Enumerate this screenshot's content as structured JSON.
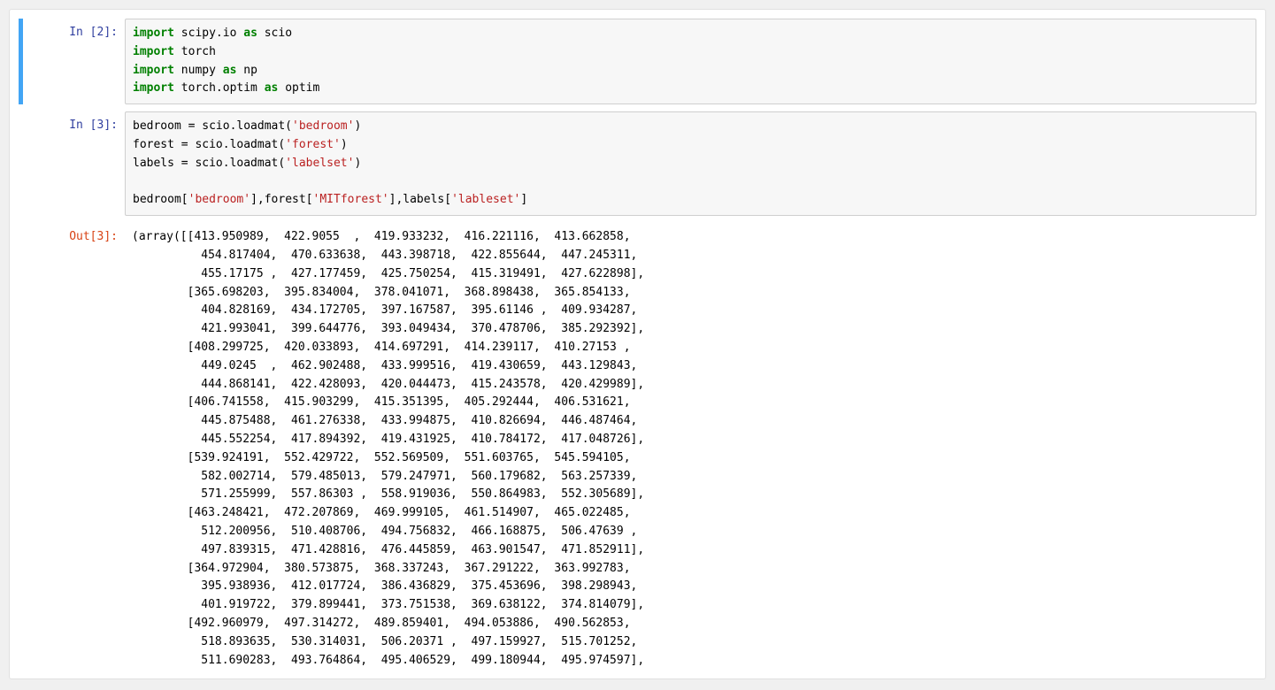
{
  "cells": [
    {
      "prompt_label": "In  [2]:",
      "selected": true,
      "code_tokens": [
        {
          "t": "import",
          "c": "kw"
        },
        {
          "t": " scipy.io ",
          "c": "nm"
        },
        {
          "t": "as",
          "c": "kw"
        },
        {
          "t": " scio",
          "c": "nm"
        },
        {
          "t": "\n",
          "c": ""
        },
        {
          "t": "import",
          "c": "kw"
        },
        {
          "t": " torch",
          "c": "nm"
        },
        {
          "t": "\n",
          "c": ""
        },
        {
          "t": "import",
          "c": "kw"
        },
        {
          "t": " numpy ",
          "c": "nm"
        },
        {
          "t": "as",
          "c": "kw"
        },
        {
          "t": " np",
          "c": "nm"
        },
        {
          "t": "\n",
          "c": ""
        },
        {
          "t": "import",
          "c": "kw"
        },
        {
          "t": " torch.optim ",
          "c": "nm"
        },
        {
          "t": "as",
          "c": "kw"
        },
        {
          "t": " optim",
          "c": "nm"
        }
      ]
    },
    {
      "prompt_label": "In  [3]:",
      "selected": false,
      "code_tokens": [
        {
          "t": "bedroom = scio.loadmat(",
          "c": "nm"
        },
        {
          "t": "'bedroom'",
          "c": "str"
        },
        {
          "t": ")",
          "c": "nm"
        },
        {
          "t": "\n",
          "c": ""
        },
        {
          "t": "forest = scio.loadmat(",
          "c": "nm"
        },
        {
          "t": "'forest'",
          "c": "str"
        },
        {
          "t": ")",
          "c": "nm"
        },
        {
          "t": "\n",
          "c": ""
        },
        {
          "t": "labels = scio.loadmat(",
          "c": "nm"
        },
        {
          "t": "'labelset'",
          "c": "str"
        },
        {
          "t": ")",
          "c": "nm"
        },
        {
          "t": "\n",
          "c": ""
        },
        {
          "t": "\n",
          "c": ""
        },
        {
          "t": "bedroom[",
          "c": "nm"
        },
        {
          "t": "'bedroom'",
          "c": "str"
        },
        {
          "t": "],forest[",
          "c": "nm"
        },
        {
          "t": "'MITforest'",
          "c": "str"
        },
        {
          "t": "],labels[",
          "c": "nm"
        },
        {
          "t": "'lableset'",
          "c": "str"
        },
        {
          "t": "]",
          "c": "nm"
        }
      ],
      "out_prompt_label": "Out[3]:",
      "output_text": "(array([[413.950989,  422.9055  ,  419.933232,  416.221116,  413.662858,\n          454.817404,  470.633638,  443.398718,  422.855644,  447.245311,\n          455.17175 ,  427.177459,  425.750254,  415.319491,  427.622898],\n        [365.698203,  395.834004,  378.041071,  368.898438,  365.854133,\n          404.828169,  434.172705,  397.167587,  395.61146 ,  409.934287,\n          421.993041,  399.644776,  393.049434,  370.478706,  385.292392],\n        [408.299725,  420.033893,  414.697291,  414.239117,  410.27153 ,\n          449.0245  ,  462.902488,  433.999516,  419.430659,  443.129843,\n          444.868141,  422.428093,  420.044473,  415.243578,  420.429989],\n        [406.741558,  415.903299,  415.351395,  405.292444,  406.531621,\n          445.875488,  461.276338,  433.994875,  410.826694,  446.487464,\n          445.552254,  417.894392,  419.431925,  410.784172,  417.048726],\n        [539.924191,  552.429722,  552.569509,  551.603765,  545.594105,\n          582.002714,  579.485013,  579.247971,  560.179682,  563.257339,\n          571.255999,  557.86303 ,  558.919036,  550.864983,  552.305689],\n        [463.248421,  472.207869,  469.999105,  461.514907,  465.022485,\n          512.200956,  510.408706,  494.756832,  466.168875,  506.47639 ,\n          497.839315,  471.428816,  476.445859,  463.901547,  471.852911],\n        [364.972904,  380.573875,  368.337243,  367.291222,  363.992783,\n          395.938936,  412.017724,  386.436829,  375.453696,  398.298943,\n          401.919722,  379.899441,  373.751538,  369.638122,  374.814079],\n        [492.960979,  497.314272,  489.859401,  494.053886,  490.562853,\n          518.893635,  530.314031,  506.20371 ,  497.159927,  515.701252,\n          511.690283,  493.764864,  495.406529,  499.180944,  495.974597],"
    }
  ]
}
